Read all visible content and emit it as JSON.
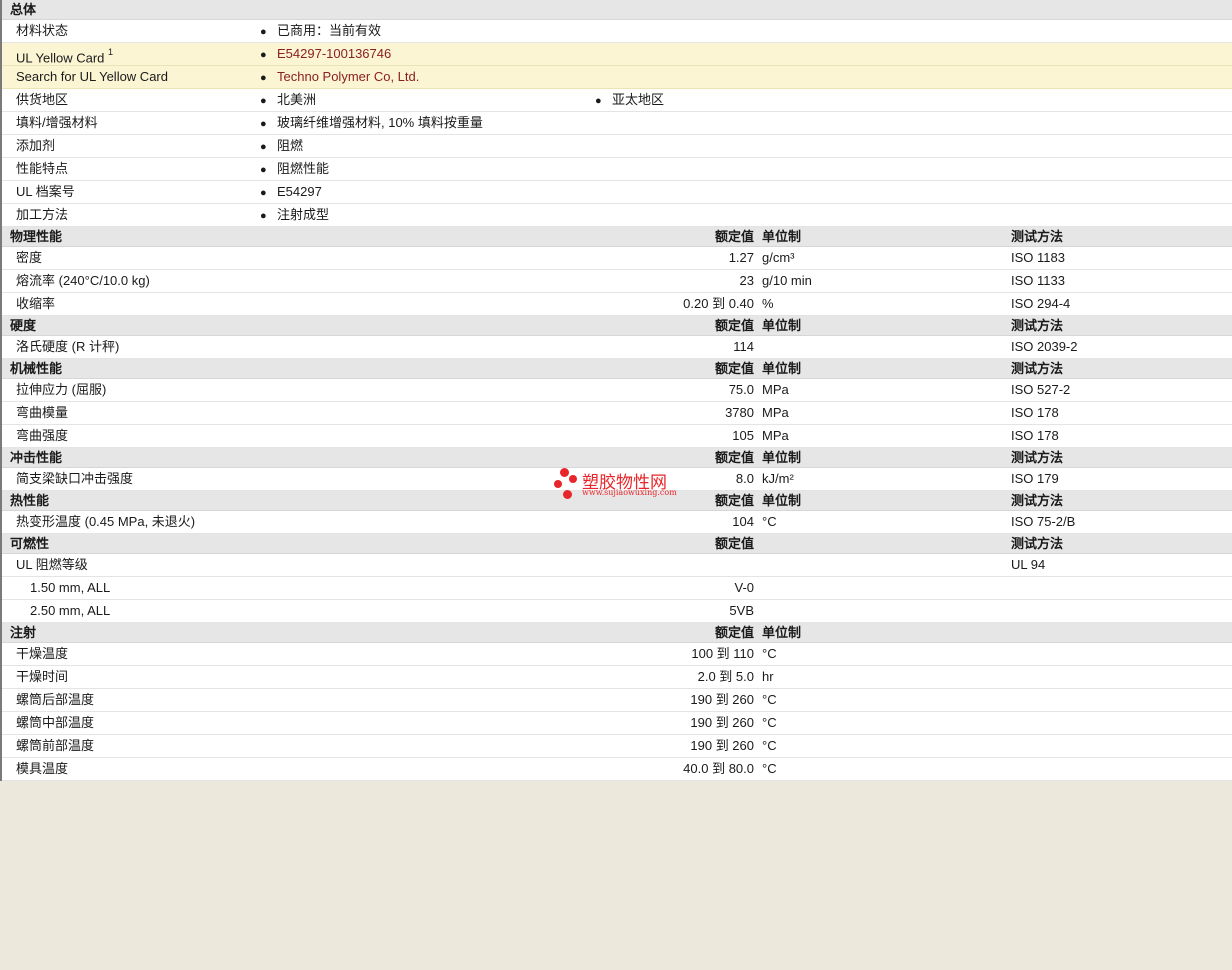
{
  "general": {
    "title": "总体",
    "rows": [
      {
        "label": "材料状态",
        "v1": "已商用：当前有效"
      },
      {
        "label": "UL Yellow Card",
        "sup": "1",
        "v1": "E54297-100136746",
        "link": true
      },
      {
        "label": "Search for UL Yellow Card",
        "v1": "Techno Polymer Co, Ltd.",
        "link": true
      },
      {
        "label": "供货地区",
        "v1": "北美洲",
        "v2": "亚太地区"
      },
      {
        "label": "填料/增强材料",
        "v1": "玻璃纤维增强材料, 10% 填料按重量"
      },
      {
        "label": "添加剂",
        "v1": "阻燃"
      },
      {
        "label": "性能特点",
        "v1": "阻燃性能"
      },
      {
        "label": "UL 档案号",
        "v1": "E54297"
      },
      {
        "label": "加工方法",
        "v1": "注射成型"
      }
    ]
  },
  "headers": {
    "value": "额定值",
    "unit": "单位制",
    "method": "测试方法"
  },
  "physical": {
    "title": "物理性能",
    "rows": [
      {
        "label": "密度",
        "value": "1.27",
        "unit": "g/cm³",
        "method": "ISO 1183"
      },
      {
        "label": "熔流率  (240°C/10.0 kg)",
        "value": "23",
        "unit": "g/10 min",
        "method": "ISO 1133"
      },
      {
        "label": "收缩率",
        "value": "0.20 到  0.40",
        "unit": "%",
        "method": "ISO 294-4"
      }
    ]
  },
  "hardness": {
    "title": "硬度",
    "rows": [
      {
        "label": "洛氏硬度  (R 计秤)",
        "value": "114",
        "unit": "",
        "method": "ISO 2039-2"
      }
    ]
  },
  "mechanical": {
    "title": "机械性能",
    "rows": [
      {
        "label": "拉伸应力  (屈服)",
        "value": "75.0",
        "unit": "MPa",
        "method": "ISO 527-2"
      },
      {
        "label": "弯曲模量",
        "value": "3780",
        "unit": "MPa",
        "method": "ISO 178"
      },
      {
        "label": "弯曲强度",
        "value": "105",
        "unit": "MPa",
        "method": "ISO 178"
      }
    ]
  },
  "impact": {
    "title": "冲击性能",
    "rows": [
      {
        "label": "简支梁缺口冲击强度",
        "value": "8.0",
        "unit": "kJ/m²",
        "method": "ISO 179"
      }
    ]
  },
  "thermal": {
    "title": "热性能",
    "rows": [
      {
        "label": "热变形温度  (0.45 MPa, 未退火)",
        "value": "104",
        "unit": "°C",
        "method": "ISO 75-2/B"
      }
    ]
  },
  "flammability": {
    "title": "可燃性",
    "rows": [
      {
        "label": "UL 阻燃等级",
        "value": "",
        "unit": "",
        "method": "UL 94"
      },
      {
        "label": "1.50 mm, ALL",
        "value": "V-0",
        "unit": "",
        "method": ""
      },
      {
        "label": "2.50 mm, ALL",
        "value": "5VB",
        "unit": "",
        "method": ""
      }
    ]
  },
  "injection": {
    "title": "注射",
    "rows": [
      {
        "label": "干燥温度",
        "value": "100 到  110",
        "unit": "°C"
      },
      {
        "label": "干燥时间",
        "value": "2.0 到  5.0",
        "unit": "hr"
      },
      {
        "label": "螺筒后部温度",
        "value": "190 到  260",
        "unit": "°C"
      },
      {
        "label": "螺筒中部温度",
        "value": "190 到  260",
        "unit": "°C"
      },
      {
        "label": "螺筒前部温度",
        "value": "190 到  260",
        "unit": "°C"
      },
      {
        "label": "模具温度",
        "value": "40.0 到  80.0",
        "unit": "°C"
      }
    ]
  },
  "watermark": {
    "text": "塑胶物性网",
    "url": "www.sujiaowuxing.com"
  },
  "colors": {
    "link": "#8b2020",
    "highlight": "#fbf5d4",
    "section": "#e6e6e6",
    "watermark": "#e8262a"
  }
}
